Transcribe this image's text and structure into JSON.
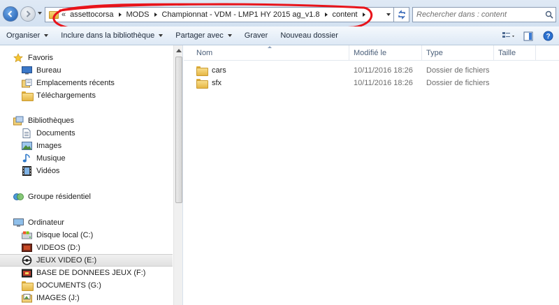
{
  "address": {
    "prefix": "«",
    "crumbs": [
      "assettocorsa",
      "MODS",
      "Championnat - VDM - LMP1 HY 2015 ag_v1.8",
      "content"
    ]
  },
  "search": {
    "placeholder": "Rechercher dans : content"
  },
  "toolbar": {
    "organize": "Organiser",
    "include": "Inclure dans la bibliothèque",
    "share": "Partager avec",
    "burn": "Graver",
    "new_folder": "Nouveau dossier"
  },
  "nav": {
    "favorites": "Favoris",
    "desktop": "Bureau",
    "recent": "Emplacements récents",
    "downloads": "Téléchargements",
    "libraries": "Bibliothèques",
    "documents": "Documents",
    "images": "Images",
    "music": "Musique",
    "videos": "Vidéos",
    "homegroup": "Groupe résidentiel",
    "computer": "Ordinateur",
    "drive_c": "Disque local (C:)",
    "drive_d": "VIDEOS (D:)",
    "drive_e": "JEUX VIDEO (E:)",
    "drive_f": "BASE DE DONNEES JEUX (F:)",
    "drive_g": "DOCUMENTS (G:)",
    "drive_j": "IMAGES (J:)"
  },
  "columns": {
    "name": "Nom",
    "date": "Modifié le",
    "type": "Type",
    "size": "Taille"
  },
  "files": [
    {
      "name": "cars",
      "date": "10/11/2016 18:26",
      "type": "Dossier de fichiers"
    },
    {
      "name": "sfx",
      "date": "10/11/2016 18:26",
      "type": "Dossier de fichiers"
    }
  ],
  "colors": {
    "annotation": "#e8141b",
    "selection": "#e4e4e4"
  }
}
